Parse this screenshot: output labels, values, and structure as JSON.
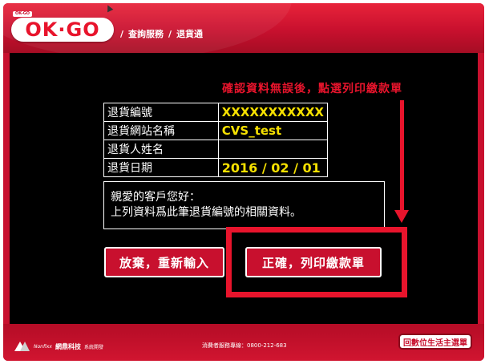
{
  "header": {
    "mini_tag": "OK-GO",
    "logo_text": "OK·GO",
    "breadcrumb": [
      "查詢服務",
      "退貨通"
    ],
    "separator": "/"
  },
  "instruction": "確認資料無誤後，點選列印繳款單",
  "table": {
    "rows": [
      {
        "label": "退貨編號",
        "value": "XXXXXXXXXXX"
      },
      {
        "label": "退貨網站名稱",
        "value": "CVS_test"
      },
      {
        "label": "退貨人姓名",
        "value": ""
      },
      {
        "label": "退貨日期",
        "value": "2016 / 02 / 01"
      }
    ]
  },
  "message": {
    "line1": "親愛的客戶您好：",
    "line2": "上列資料爲此筆退貨編號的相關資料。"
  },
  "buttons": {
    "cancel": "放棄，重新輸入",
    "confirm": "正確，列印繳款單"
  },
  "footer": {
    "brand": "Nonfixx",
    "company": "網鼎科技",
    "dev_label": "系統開發",
    "hotline": "消費者服務專線：0800-212-683",
    "home_button": "回數位生活主選單"
  },
  "colors": {
    "brand_red": "#c8102e",
    "highlight_red": "#e8142c",
    "value_yellow": "#f5e000",
    "background_black": "#000000"
  }
}
